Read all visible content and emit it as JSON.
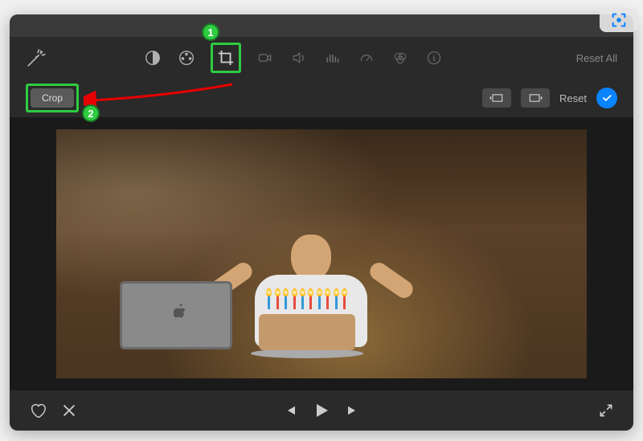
{
  "annotations": {
    "badge1": "1",
    "badge2": "2"
  },
  "toolbar": {
    "reset_all": "Reset All"
  },
  "subtoolbar": {
    "crop_label": "Crop",
    "reset_label": "Reset"
  },
  "icons": {
    "magic_wand": "magic-wand-icon",
    "contrast": "contrast-icon",
    "color_wheel": "color-wheel-icon",
    "crop": "crop-icon",
    "camera": "camera-icon",
    "volume": "volume-icon",
    "equalizer": "equalizer-icon",
    "speed": "speedometer-icon",
    "color_balance": "color-balance-icon",
    "info": "info-icon",
    "rotate_ccw": "rotate-ccw-icon",
    "rotate_cw": "rotate-cw-icon",
    "checkmark": "checkmark-icon",
    "heart": "heart-icon",
    "reject": "reject-icon",
    "prev": "previous-icon",
    "play": "play-icon",
    "next": "next-icon",
    "fullscreen": "fullscreen-icon",
    "capture": "capture-icon"
  }
}
